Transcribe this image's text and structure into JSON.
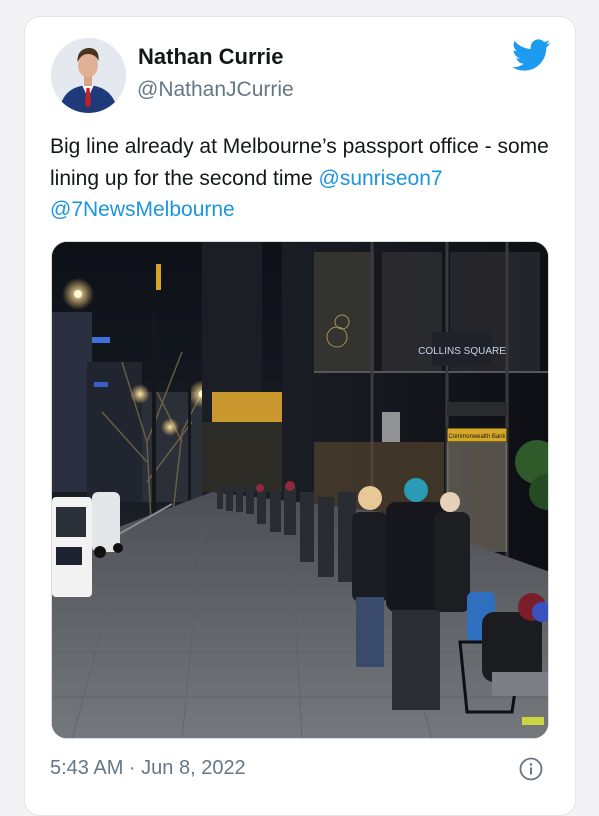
{
  "author": {
    "name": "Nathan Currie",
    "handle": "@NathanJCurrie"
  },
  "tweet": {
    "text": "Big line already at Melbourne’s passport office - some lining up for the second time ",
    "mention_1": "@sunriseon7",
    "separator": " ",
    "mention_2": "@7NewsMelbourne"
  },
  "photo": {
    "description_icon": "street-photo",
    "sign_text": "Commonwealth Bank",
    "building_text": "COLLINS SQUARE"
  },
  "footer": {
    "timestamp": "5:43 AM · Jun 8, 2022"
  },
  "icons": {
    "brand": "twitter-bird-icon",
    "info": "info-icon"
  },
  "colors": {
    "brand_blue": "#1d9bf0",
    "link_blue": "#1b95e0",
    "secondary_text": "#657786",
    "primary_text": "#14171a"
  }
}
